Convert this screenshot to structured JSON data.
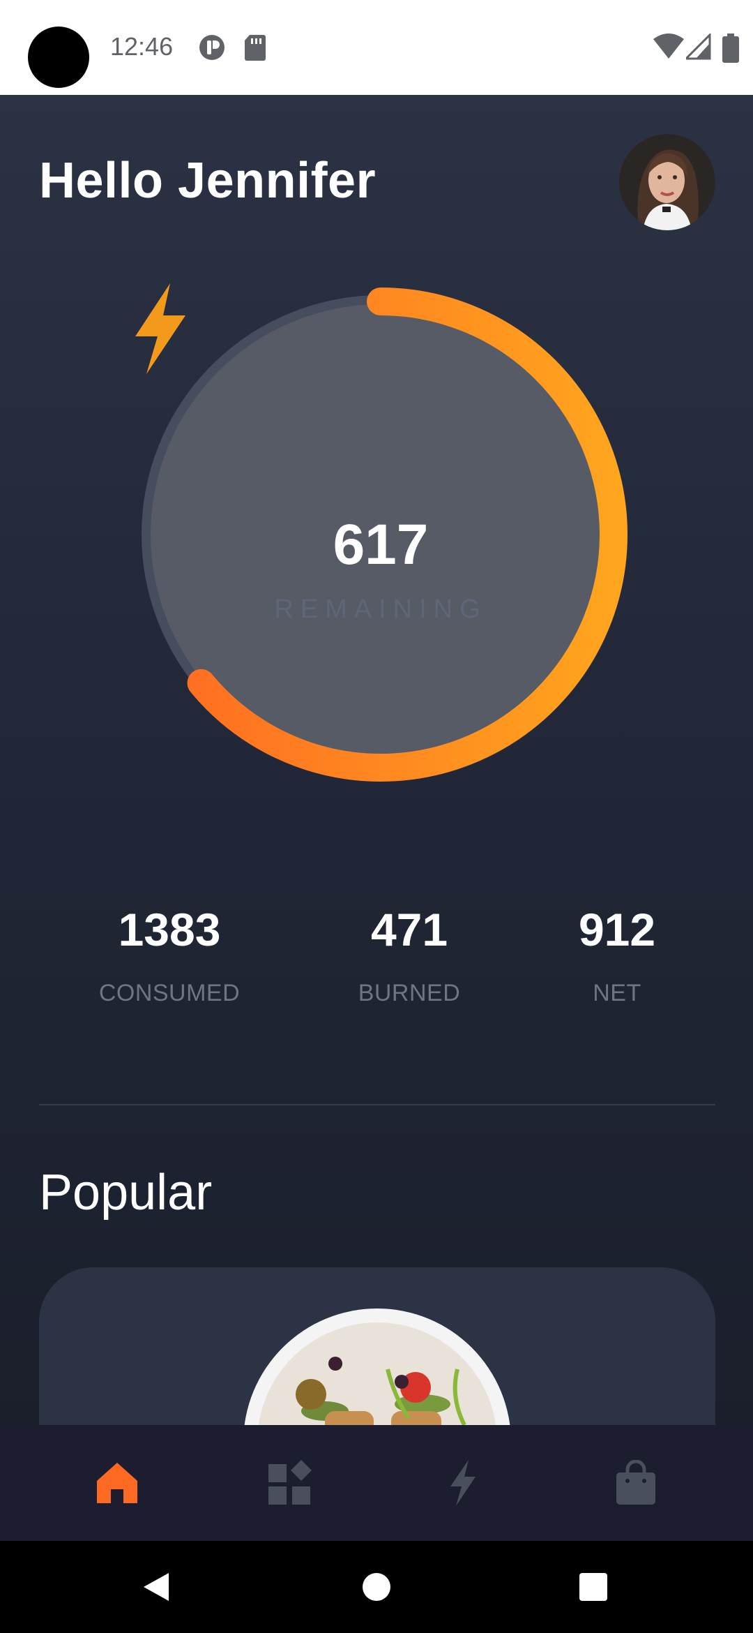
{
  "status_bar": {
    "time": "12:46",
    "icons": [
      "notification-icon",
      "sd-card-icon",
      "wifi-icon",
      "signal-icon",
      "battery-icon"
    ]
  },
  "header": {
    "greeting": "Hello Jennifer",
    "avatar": "profile-photo"
  },
  "ring": {
    "value": "617",
    "label": "REMAINING",
    "progress_fraction": 0.64,
    "icon": "bolt-icon",
    "colors": {
      "start": "#ff6a22",
      "end": "#ffa51e",
      "track": "#464d5e",
      "fill": "#565b66"
    }
  },
  "stats": [
    {
      "value": "1383",
      "label": "CONSUMED"
    },
    {
      "value": "471",
      "label": "BURNED"
    },
    {
      "value": "912",
      "label": "NET"
    }
  ],
  "popular": {
    "title": "Popular",
    "card_image": "salad-bowl"
  },
  "bottom_nav": {
    "items": [
      {
        "icon": "home-icon",
        "active": true
      },
      {
        "icon": "widgets-icon",
        "active": false
      },
      {
        "icon": "bolt-icon",
        "active": false
      },
      {
        "icon": "shopping-bag-icon",
        "active": false
      }
    ],
    "active_color": "#ff6a22",
    "inactive_color": "#4a4f5e"
  },
  "system_nav": [
    "back-icon",
    "home-circle-icon",
    "recents-icon"
  ]
}
